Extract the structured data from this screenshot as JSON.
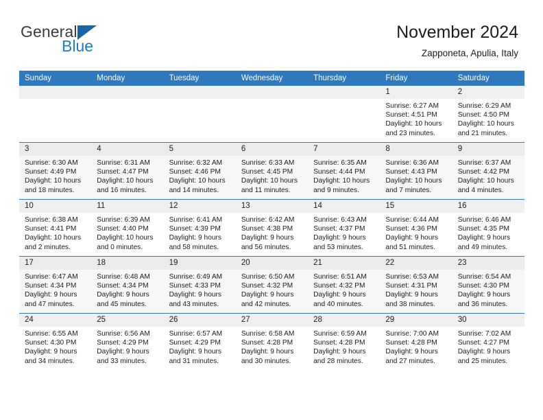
{
  "logo": {
    "word_top": "General",
    "word_bottom": "Blue",
    "triangle_color": "#1767a8",
    "blue_color": "#1a7dc4"
  },
  "header": {
    "title": "November 2024",
    "subtitle": "Zapponeta, Apulia, Italy"
  },
  "theme": {
    "header_blue": "#2e78bd",
    "daynum_band": "#efefef",
    "row_shaded": "#f7f7f7"
  },
  "weekdays": [
    "Sunday",
    "Monday",
    "Tuesday",
    "Wednesday",
    "Thursday",
    "Friday",
    "Saturday"
  ],
  "weeks": [
    [
      {
        "day": "",
        "lines": []
      },
      {
        "day": "",
        "lines": []
      },
      {
        "day": "",
        "lines": []
      },
      {
        "day": "",
        "lines": []
      },
      {
        "day": "",
        "lines": []
      },
      {
        "day": "1",
        "lines": [
          "Sunrise: 6:27 AM",
          "Sunset: 4:51 PM",
          "Daylight: 10 hours",
          "and 23 minutes."
        ]
      },
      {
        "day": "2",
        "lines": [
          "Sunrise: 6:29 AM",
          "Sunset: 4:50 PM",
          "Daylight: 10 hours",
          "and 21 minutes."
        ]
      }
    ],
    [
      {
        "day": "3",
        "lines": [
          "Sunrise: 6:30 AM",
          "Sunset: 4:49 PM",
          "Daylight: 10 hours",
          "and 18 minutes."
        ]
      },
      {
        "day": "4",
        "lines": [
          "Sunrise: 6:31 AM",
          "Sunset: 4:47 PM",
          "Daylight: 10 hours",
          "and 16 minutes."
        ]
      },
      {
        "day": "5",
        "lines": [
          "Sunrise: 6:32 AM",
          "Sunset: 4:46 PM",
          "Daylight: 10 hours",
          "and 14 minutes."
        ]
      },
      {
        "day": "6",
        "lines": [
          "Sunrise: 6:33 AM",
          "Sunset: 4:45 PM",
          "Daylight: 10 hours",
          "and 11 minutes."
        ]
      },
      {
        "day": "7",
        "lines": [
          "Sunrise: 6:35 AM",
          "Sunset: 4:44 PM",
          "Daylight: 10 hours",
          "and 9 minutes."
        ]
      },
      {
        "day": "8",
        "lines": [
          "Sunrise: 6:36 AM",
          "Sunset: 4:43 PM",
          "Daylight: 10 hours",
          "and 7 minutes."
        ]
      },
      {
        "day": "9",
        "lines": [
          "Sunrise: 6:37 AM",
          "Sunset: 4:42 PM",
          "Daylight: 10 hours",
          "and 4 minutes."
        ]
      }
    ],
    [
      {
        "day": "10",
        "lines": [
          "Sunrise: 6:38 AM",
          "Sunset: 4:41 PM",
          "Daylight: 10 hours",
          "and 2 minutes."
        ]
      },
      {
        "day": "11",
        "lines": [
          "Sunrise: 6:39 AM",
          "Sunset: 4:40 PM",
          "Daylight: 10 hours",
          "and 0 minutes."
        ]
      },
      {
        "day": "12",
        "lines": [
          "Sunrise: 6:41 AM",
          "Sunset: 4:39 PM",
          "Daylight: 9 hours",
          "and 58 minutes."
        ]
      },
      {
        "day": "13",
        "lines": [
          "Sunrise: 6:42 AM",
          "Sunset: 4:38 PM",
          "Daylight: 9 hours",
          "and 56 minutes."
        ]
      },
      {
        "day": "14",
        "lines": [
          "Sunrise: 6:43 AM",
          "Sunset: 4:37 PM",
          "Daylight: 9 hours",
          "and 53 minutes."
        ]
      },
      {
        "day": "15",
        "lines": [
          "Sunrise: 6:44 AM",
          "Sunset: 4:36 PM",
          "Daylight: 9 hours",
          "and 51 minutes."
        ]
      },
      {
        "day": "16",
        "lines": [
          "Sunrise: 6:46 AM",
          "Sunset: 4:35 PM",
          "Daylight: 9 hours",
          "and 49 minutes."
        ]
      }
    ],
    [
      {
        "day": "17",
        "lines": [
          "Sunrise: 6:47 AM",
          "Sunset: 4:34 PM",
          "Daylight: 9 hours",
          "and 47 minutes."
        ]
      },
      {
        "day": "18",
        "lines": [
          "Sunrise: 6:48 AM",
          "Sunset: 4:34 PM",
          "Daylight: 9 hours",
          "and 45 minutes."
        ]
      },
      {
        "day": "19",
        "lines": [
          "Sunrise: 6:49 AM",
          "Sunset: 4:33 PM",
          "Daylight: 9 hours",
          "and 43 minutes."
        ]
      },
      {
        "day": "20",
        "lines": [
          "Sunrise: 6:50 AM",
          "Sunset: 4:32 PM",
          "Daylight: 9 hours",
          "and 42 minutes."
        ]
      },
      {
        "day": "21",
        "lines": [
          "Sunrise: 6:51 AM",
          "Sunset: 4:32 PM",
          "Daylight: 9 hours",
          "and 40 minutes."
        ]
      },
      {
        "day": "22",
        "lines": [
          "Sunrise: 6:53 AM",
          "Sunset: 4:31 PM",
          "Daylight: 9 hours",
          "and 38 minutes."
        ]
      },
      {
        "day": "23",
        "lines": [
          "Sunrise: 6:54 AM",
          "Sunset: 4:30 PM",
          "Daylight: 9 hours",
          "and 36 minutes."
        ]
      }
    ],
    [
      {
        "day": "24",
        "lines": [
          "Sunrise: 6:55 AM",
          "Sunset: 4:30 PM",
          "Daylight: 9 hours",
          "and 34 minutes."
        ]
      },
      {
        "day": "25",
        "lines": [
          "Sunrise: 6:56 AM",
          "Sunset: 4:29 PM",
          "Daylight: 9 hours",
          "and 33 minutes."
        ]
      },
      {
        "day": "26",
        "lines": [
          "Sunrise: 6:57 AM",
          "Sunset: 4:29 PM",
          "Daylight: 9 hours",
          "and 31 minutes."
        ]
      },
      {
        "day": "27",
        "lines": [
          "Sunrise: 6:58 AM",
          "Sunset: 4:28 PM",
          "Daylight: 9 hours",
          "and 30 minutes."
        ]
      },
      {
        "day": "28",
        "lines": [
          "Sunrise: 6:59 AM",
          "Sunset: 4:28 PM",
          "Daylight: 9 hours",
          "and 28 minutes."
        ]
      },
      {
        "day": "29",
        "lines": [
          "Sunrise: 7:00 AM",
          "Sunset: 4:28 PM",
          "Daylight: 9 hours",
          "and 27 minutes."
        ]
      },
      {
        "day": "30",
        "lines": [
          "Sunrise: 7:02 AM",
          "Sunset: 4:27 PM",
          "Daylight: 9 hours",
          "and 25 minutes."
        ]
      }
    ]
  ]
}
